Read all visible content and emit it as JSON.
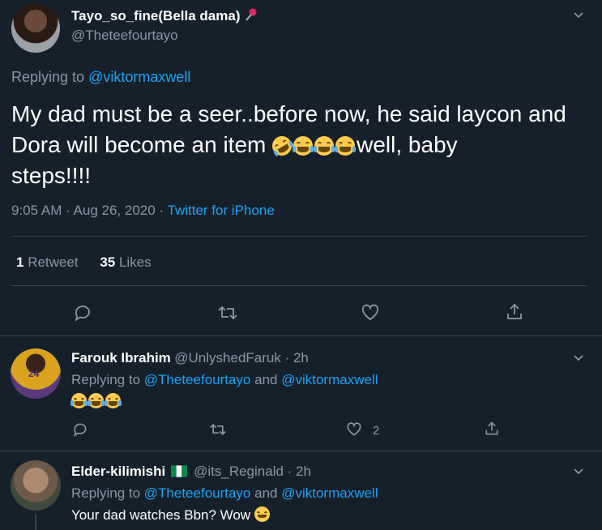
{
  "main_tweet": {
    "display_name": "Tayo_so_fine(Bella dama)",
    "handle": "@Theteefourtayo",
    "replying_prefix": "Replying to ",
    "replying_to": "@viktormaxwell",
    "text_line1": "My dad must be a seer..before now, he said laycon and",
    "text_line2_a": "Dora will become an item ",
    "text_line2_b": "well, baby",
    "text_line3": "steps!!!!",
    "time": "9:05 AM · Aug 26, 2020 · ",
    "source": "Twitter for iPhone",
    "retweets_count": "1",
    "retweets_label": "Retweet",
    "likes_count": "35",
    "likes_label": "Likes"
  },
  "replies": [
    {
      "display_name": "Farouk Ibrahim",
      "handle_time": "@UnlyshedFaruk · 2h",
      "replying_prefix": "Replying to ",
      "replying_to_1": "@Theteefourtayo",
      "replying_and": " and ",
      "replying_to_2": "@viktormaxwell",
      "like_count": "2",
      "avatar_jersey": "24"
    },
    {
      "display_name": "Elder-kilimishi",
      "handle_time": "@its_Reginald · 2h",
      "replying_prefix": "Replying to ",
      "replying_to_1": "@Theteefourtayo",
      "replying_and": " and ",
      "replying_to_2": "@viktormaxwell",
      "text": "Your dad watches Bbn? Wow "
    }
  ],
  "colors": {
    "background": "#15202b",
    "link": "#1da1f2",
    "muted": "#8899a6",
    "divider": "#38444d"
  },
  "icons": [
    "pushpin-icon",
    "chevron-down-icon",
    "reply-icon",
    "retweet-icon",
    "like-icon",
    "share-icon",
    "nigeria-flag-icon"
  ]
}
